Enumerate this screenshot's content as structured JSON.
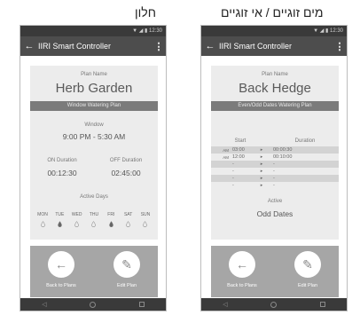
{
  "captions": {
    "left": "חלון",
    "right": "מים זוגיים / אי זוגיים"
  },
  "left_phone": {
    "status": "▼ ◢ ▮ 12:30",
    "app_title": "IIRI Smart Controller",
    "plan_label": "Plan Name",
    "plan_name": "Herb Garden",
    "plan_type": "Window Watering Plan",
    "window_label": "Window",
    "window_value": "9:00 PM - 5:30 AM",
    "on_label": "ON Duration",
    "on_value": "00:12:30",
    "off_label": "OFF Duration",
    "off_value": "02:45:00",
    "active_days_label": "Active Days",
    "days": [
      {
        "label": "MON",
        "active": false
      },
      {
        "label": "TUE",
        "active": true
      },
      {
        "label": "WED",
        "active": false
      },
      {
        "label": "THU",
        "active": false
      },
      {
        "label": "FRI",
        "active": true
      },
      {
        "label": "SAT",
        "active": false
      },
      {
        "label": "SUN",
        "active": false
      }
    ],
    "back_label": "Back to Plans",
    "edit_label": "Edit Plan"
  },
  "right_phone": {
    "status": "▼ ◢ ▮ 12:30",
    "app_title": "IIRI Smart Controller",
    "plan_label": "Plan Name",
    "plan_name": "Back Hedge",
    "plan_type": "Even/Odd Dates Watering Plan",
    "start_label": "Start",
    "duration_label": "Duration",
    "rows": [
      {
        "ampm": "AM",
        "start": "03:00",
        "duration": "00:00:30"
      },
      {
        "ampm": "AM",
        "start": "12:00",
        "duration": "00:10:00"
      },
      {
        "ampm": "",
        "start": "-",
        "duration": "-"
      },
      {
        "ampm": "",
        "start": "-",
        "duration": "-"
      },
      {
        "ampm": "",
        "start": "-",
        "duration": "-"
      },
      {
        "ampm": "",
        "start": "-",
        "duration": "-"
      }
    ],
    "active_label": "Active",
    "active_value": "Odd Dates",
    "back_label": "Back to Plans",
    "edit_label": "Edit Plan"
  },
  "colors": {
    "app_bar": "#4d4d4d",
    "card": "#ececec",
    "panel": "#a6a6a6",
    "banner": "#7b7b7b"
  }
}
